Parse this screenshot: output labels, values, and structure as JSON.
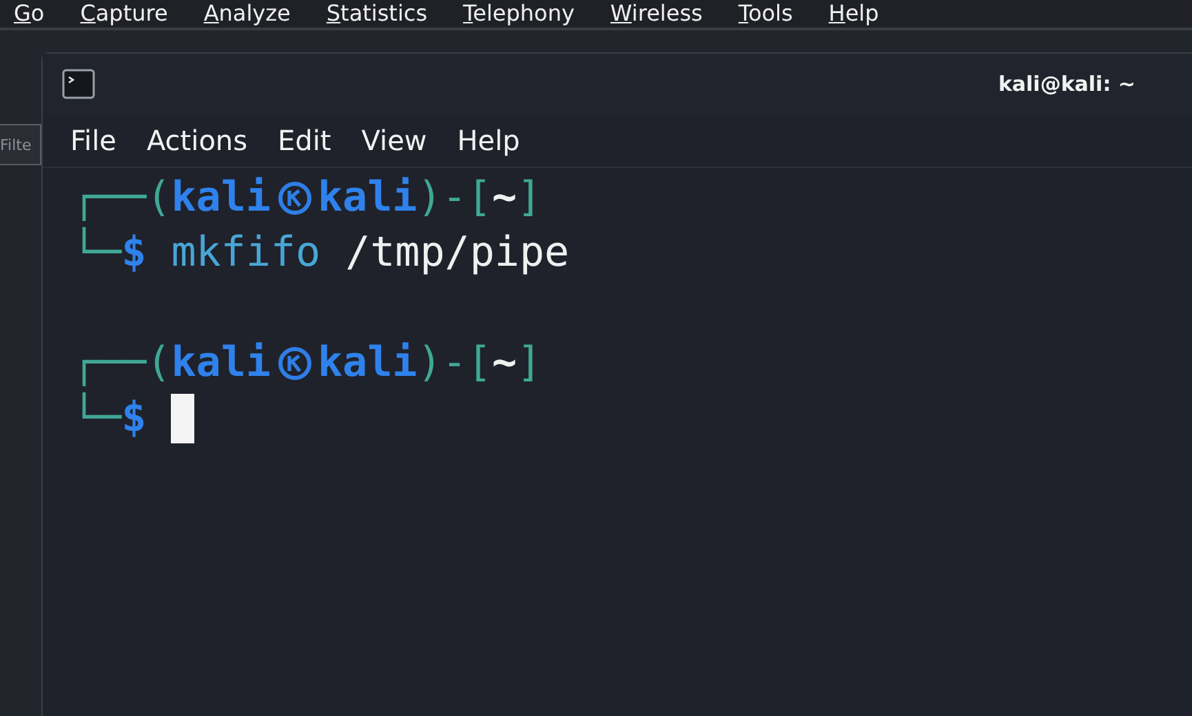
{
  "background_app": {
    "menu": [
      {
        "label": "Go"
      },
      {
        "label": "Capture"
      },
      {
        "label": "Analyze"
      },
      {
        "label": "Statistics"
      },
      {
        "label": "Telephony"
      },
      {
        "label": "Wireless"
      },
      {
        "label": "Tools"
      },
      {
        "label": "Help"
      }
    ],
    "filter_field": {
      "placeholder": "Filte"
    }
  },
  "terminal": {
    "title": "kali@kali: ~",
    "menu": [
      "File",
      "Actions",
      "Edit",
      "View",
      "Help"
    ],
    "blocks": [
      {
        "corner_top": "┌──(",
        "user": "kali",
        "host": "kali",
        "cwd_open": ")-[",
        "cwd": "~",
        "cwd_close": "]",
        "corner_bottom": "└─",
        "prompt": "$",
        "command": "mkfifo",
        "argument": "/tmp/pipe",
        "cursor": false
      },
      {
        "corner_top": "┌──(",
        "user": "kali",
        "host": "kali",
        "cwd_open": ")-[",
        "cwd": "~",
        "cwd_close": "]",
        "corner_bottom": "└─",
        "prompt": "$",
        "cursor": true
      }
    ]
  }
}
